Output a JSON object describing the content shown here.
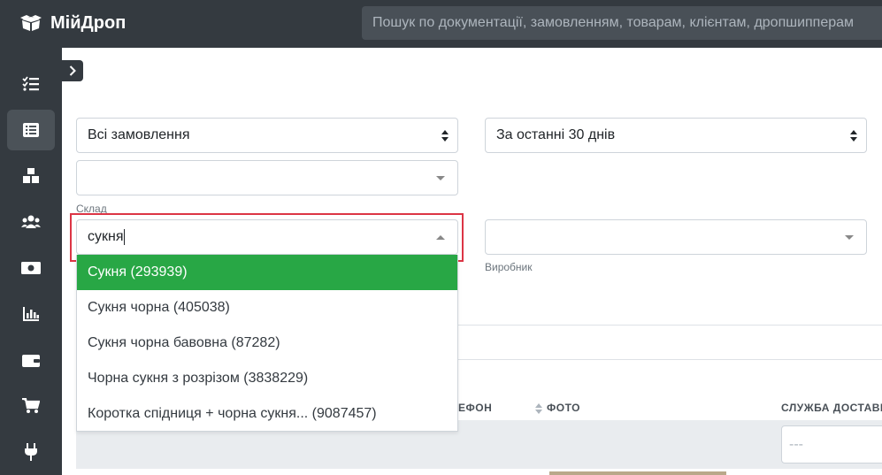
{
  "header": {
    "brand": "МійДроп",
    "search_placeholder": "Пошук по документації, замовленням, товарам, клієнтам, дропшипперам"
  },
  "sidebar": {
    "items": [
      {
        "icon": "tasks-icon"
      },
      {
        "icon": "list-icon",
        "active": true
      },
      {
        "icon": "boxes-icon"
      },
      {
        "icon": "users-icon"
      },
      {
        "icon": "money-icon"
      },
      {
        "icon": "chart-icon"
      },
      {
        "icon": "wallet-icon"
      },
      {
        "icon": "cart-icon"
      },
      {
        "icon": "plug-icon"
      }
    ]
  },
  "filters": {
    "orders_select": "Всі замовлення",
    "period_select": "За останні 30 днів",
    "warehouse_label": "Склад",
    "product_search_value": "сукня",
    "manufacturer_label": "Виробник"
  },
  "dropdown": {
    "options": [
      "Сукня (293939)",
      "Сукня чорна (405038)",
      "Сукня чорна бавовна (87282)",
      "Чорна сукня з розрізом (3838229)",
      "Коротка спідниця + чорна сукня... (9087457)"
    ]
  },
  "table": {
    "headers": {
      "phone": "ЕФОН",
      "photo": "ФОТО",
      "delivery": "СЛУЖБА ДОСТАВКИ"
    },
    "filter_placeholder": "---"
  },
  "colors": {
    "topbar": "#343a40",
    "highlight": "#28a745",
    "annotation": "#dc3545"
  }
}
